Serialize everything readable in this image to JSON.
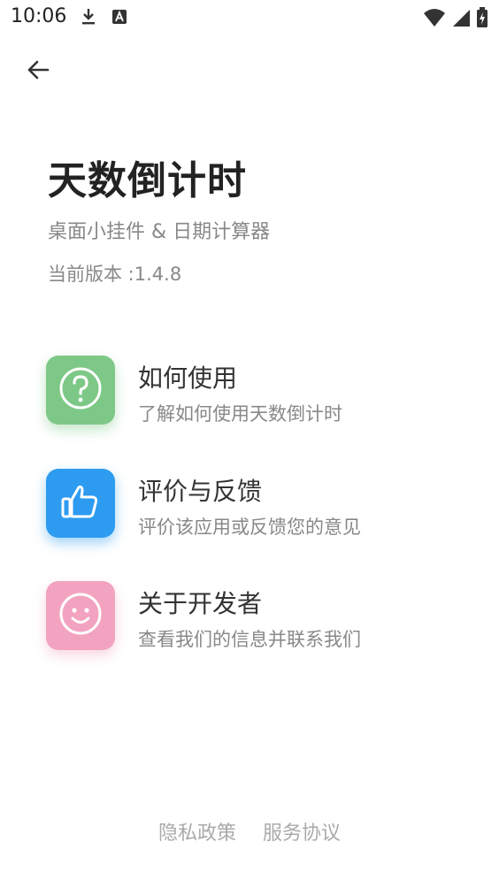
{
  "status_bar": {
    "time": "10:06",
    "left_icons": [
      "download-icon",
      "font-a-icon"
    ],
    "right_icons": [
      "wifi-icon",
      "signal-icon",
      "battery-charging-icon"
    ]
  },
  "header": {
    "back_icon": "arrow-left-icon"
  },
  "app": {
    "title": "天数倒计时",
    "subtitle": "桌面小挂件 & 日期计算器",
    "version": "当前版本 :1.4.8"
  },
  "menu": [
    {
      "title": "如何使用",
      "desc": "了解如何使用天数倒计时",
      "icon": "question-circle-icon",
      "color": "#7dc886"
    },
    {
      "title": "评价与反馈",
      "desc": "评价该应用或反馈您的意见",
      "icon": "thumbs-up-icon",
      "color": "#2d9bf0"
    },
    {
      "title": "关于开发者",
      "desc": "查看我们的信息并联系我们",
      "icon": "smiley-icon",
      "color": "#f2a3bf"
    }
  ],
  "footer": {
    "privacy": "隐私政策",
    "terms": "服务协议"
  }
}
